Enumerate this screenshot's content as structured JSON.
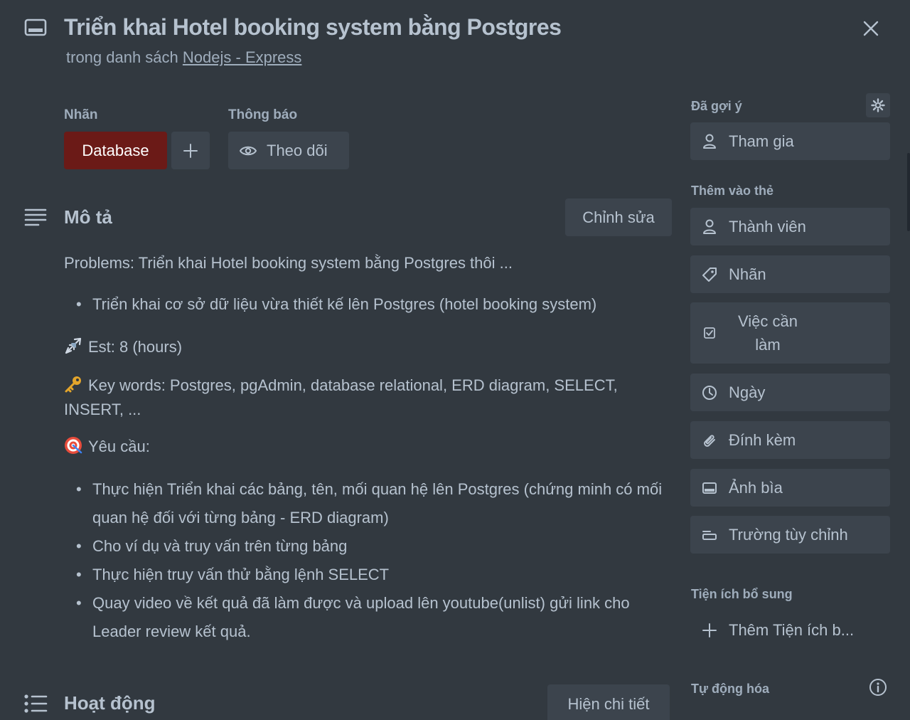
{
  "card": {
    "title": "Triển khai Hotel booking system bằng Postgres",
    "list_prefix": "trong danh sách ",
    "list_name": "Nodejs - Express"
  },
  "labels": {
    "heading": "Nhãn",
    "items": [
      "Database"
    ],
    "label_color": "#6b1a17"
  },
  "notifications": {
    "heading": "Thông báo",
    "follow_label": "Theo dõi"
  },
  "description": {
    "heading": "Mô tả",
    "edit_label": "Chỉnh sửa",
    "problems": "Problems: Triển khai Hotel booking system bằng Postgres thôi ...",
    "bullets1": [
      "Triển khai cơ sở dữ liệu vừa thiết kế lên Postgres (hotel booking system)"
    ],
    "est": "Est: 8 (hours)",
    "keywords": "Key words: Postgres, pgAdmin, database relational, ERD diagram, SELECT, INSERT, ...",
    "requirements_heading": "Yêu cầu:",
    "requirements": [
      "Thực hiện Triển khai các bảng, tên, mối quan hệ lên Postgres (chứng minh có mối quan hệ đối với từng bảng - ERD diagram)",
      "Cho ví dụ và truy vấn trên từng bảng",
      "Thực hiện truy vấn thử bằng lệnh SELECT",
      "Quay video về kết quả đã làm được và upload lên youtube(unlist) gửi link cho Leader review kết quả."
    ]
  },
  "activity": {
    "heading": "Hoạt động",
    "detail_label": "Hiện chi tiết"
  },
  "sidebar": {
    "suggested_heading": "Đã gợi ý",
    "join_label": "Tham gia",
    "add_to_card_heading": "Thêm vào thẻ",
    "add_items": [
      {
        "label": "Thành viên",
        "icon": "person-icon"
      },
      {
        "label": "Nhãn",
        "icon": "tag-icon"
      },
      {
        "label": "Việc cần làm",
        "icon": "checklist-icon"
      },
      {
        "label": "Ngày",
        "icon": "clock-icon"
      },
      {
        "label": "Đính kèm",
        "icon": "paperclip-icon"
      },
      {
        "label": "Ảnh bìa",
        "icon": "cover-icon"
      },
      {
        "label": "Trường tùy chỉnh",
        "icon": "custom-field-icon"
      }
    ],
    "powerups_heading": "Tiện ích bổ sung",
    "add_powerup_label": "Thêm Tiện ích b...",
    "automation_heading": "Tự động hóa"
  },
  "colors": {
    "background": "#323940",
    "button": "#3c444d",
    "text": "#b6c2cf",
    "muted": "#9fadbc"
  }
}
